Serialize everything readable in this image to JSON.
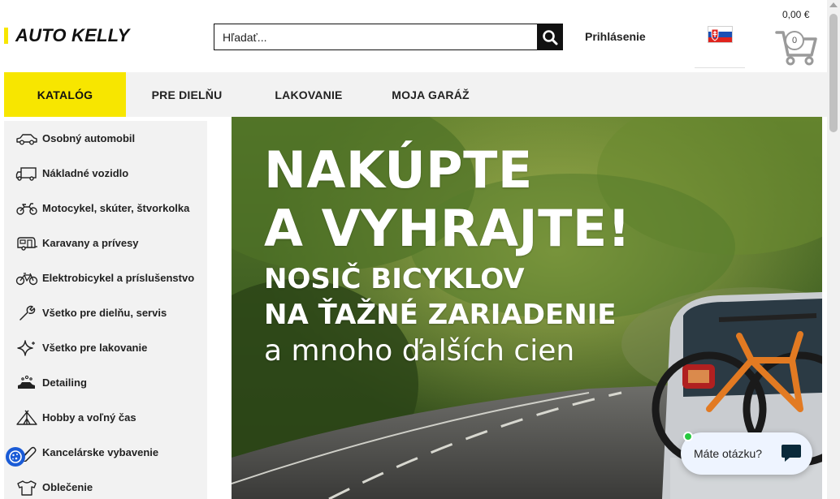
{
  "header": {
    "logo_text": "AUTO KELLY",
    "search_placeholder": "Hľadať...",
    "login_label": "Prihlásenie",
    "cart_price": "0,00 €",
    "cart_count": "0"
  },
  "nav": {
    "items": [
      {
        "label": "KATALÓG",
        "active": true
      },
      {
        "label": "PRE DIELŇU",
        "active": false
      },
      {
        "label": "LAKOVANIE",
        "active": false
      },
      {
        "label": "MOJA GARÁŽ",
        "active": false
      }
    ]
  },
  "sidebar": {
    "items": [
      {
        "label": "Osobný automobil",
        "icon": "car-icon"
      },
      {
        "label": "Nákladné vozidlo",
        "icon": "truck-icon"
      },
      {
        "label": "Motocykel, skúter, štvorkolka",
        "icon": "motorcycle-icon"
      },
      {
        "label": "Karavany a prívesy",
        "icon": "caravan-icon"
      },
      {
        "label": "Elektrobicykel a príslušenstvo",
        "icon": "bicycle-icon"
      },
      {
        "label": "Všetko pre dielňu, servis",
        "icon": "wrench-icon"
      },
      {
        "label": "Všetko pre lakovanie",
        "icon": "sparkle-icon"
      },
      {
        "label": "Detailing",
        "icon": "car-wash-icon"
      },
      {
        "label": "Hobby a voľný čas",
        "icon": "tent-icon"
      },
      {
        "label": "Kancelárske vybavenie",
        "icon": "paperclip-icon"
      },
      {
        "label": "Oblečenie",
        "icon": "tshirt-icon"
      }
    ]
  },
  "banner": {
    "line1": "NAKÚPTE",
    "line2": "A VYHRAJTE!",
    "line3": "NOSIČ BICYKLOV",
    "line4": "NA ŤAŽNÉ ZARIADENIE",
    "line5": "a mnoho ďalších cien"
  },
  "chat": {
    "label": "Máte otázku?"
  },
  "colors": {
    "brand_yellow": "#f7e600",
    "nav_bg": "#f2f2f2",
    "text_dark": "#111111"
  }
}
